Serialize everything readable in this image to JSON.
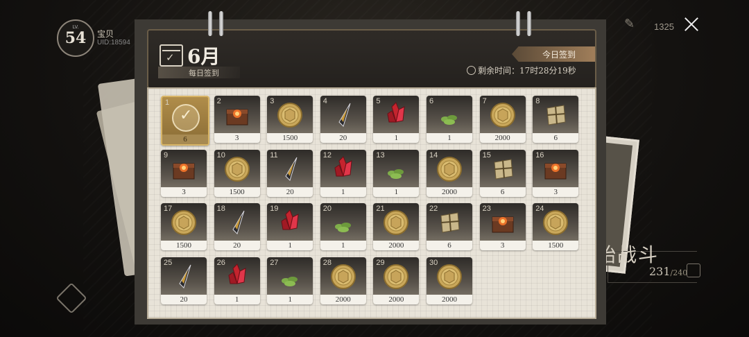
{
  "player": {
    "level_prefix": "LV.",
    "level": "54",
    "name": "宝贝",
    "uid": "UID:18594"
  },
  "topbar": {
    "count": "1325",
    "close_icon": "close-icon"
  },
  "calendar": {
    "month": "6月",
    "subtitle": "每日签到",
    "today_label": "今日签到",
    "remaining": "剩余时间：17时28分19秒",
    "days": [
      {
        "day": "1",
        "item": "signed",
        "qty": "6",
        "signed": true
      },
      {
        "day": "2",
        "item": "chest",
        "qty": "3"
      },
      {
        "day": "3",
        "item": "coin",
        "qty": "1500"
      },
      {
        "day": "4",
        "item": "feather",
        "qty": "20"
      },
      {
        "day": "5",
        "item": "crystal",
        "qty": "1"
      },
      {
        "day": "6",
        "item": "herb",
        "qty": "1"
      },
      {
        "day": "7",
        "item": "coin",
        "qty": "2000"
      },
      {
        "day": "8",
        "item": "bundle",
        "qty": "6"
      },
      {
        "day": "9",
        "item": "chest",
        "qty": "3"
      },
      {
        "day": "10",
        "item": "coin",
        "qty": "1500"
      },
      {
        "day": "11",
        "item": "feather",
        "qty": "20"
      },
      {
        "day": "12",
        "item": "crystal",
        "qty": "1"
      },
      {
        "day": "13",
        "item": "herb",
        "qty": "1"
      },
      {
        "day": "14",
        "item": "coin",
        "qty": "2000"
      },
      {
        "day": "15",
        "item": "bundle",
        "qty": "6"
      },
      {
        "day": "16",
        "item": "chest",
        "qty": "3"
      },
      {
        "day": "17",
        "item": "coin",
        "qty": "1500"
      },
      {
        "day": "18",
        "item": "feather",
        "qty": "20"
      },
      {
        "day": "19",
        "item": "crystal",
        "qty": "1"
      },
      {
        "day": "20",
        "item": "herb",
        "qty": "1"
      },
      {
        "day": "21",
        "item": "coin",
        "qty": "2000"
      },
      {
        "day": "22",
        "item": "bundle",
        "qty": "6"
      },
      {
        "day": "23",
        "item": "chest",
        "qty": "3"
      },
      {
        "day": "24",
        "item": "coin",
        "qty": "1500"
      },
      {
        "day": "25",
        "item": "feather",
        "qty": "20"
      },
      {
        "day": "26",
        "item": "crystal",
        "qty": "1"
      },
      {
        "day": "27",
        "item": "herb",
        "qty": "1"
      },
      {
        "day": "28",
        "item": "coin",
        "qty": "2000"
      },
      {
        "day": "29",
        "item": "coin",
        "qty": "2000"
      },
      {
        "day": "30",
        "item": "coin",
        "qty": "2000"
      }
    ]
  },
  "side": {
    "battle": "始战斗",
    "stamina": "231",
    "stamina_max": "/240"
  }
}
